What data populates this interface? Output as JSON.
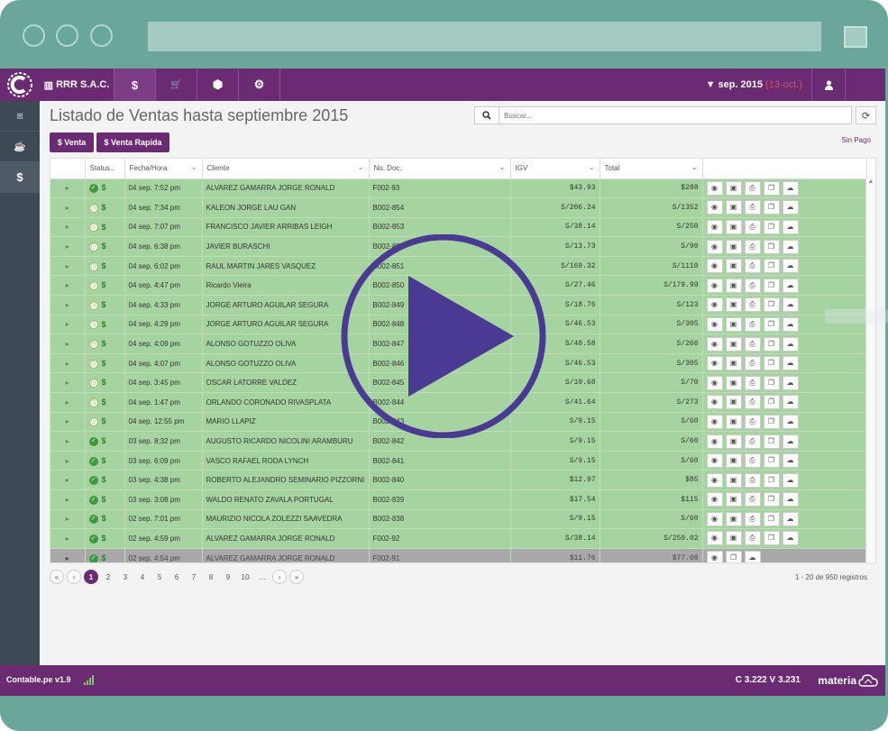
{
  "browser": {
    "window_dots": 3
  },
  "header": {
    "logo_icon": "company-c-logo",
    "company": "RRR S.A.C.",
    "nav": [
      {
        "name": "dollar-icon",
        "glyph": "$"
      },
      {
        "name": "cart-icon",
        "glyph": "🛒"
      },
      {
        "name": "box-icon",
        "glyph": "⬢"
      },
      {
        "name": "gears-icon",
        "glyph": "⚙"
      }
    ],
    "period": "sep. 2015",
    "period_note": "(13-oct.)",
    "filter_icon": "filter-icon",
    "user_icon": "user-icon"
  },
  "sidebar": {
    "items": [
      {
        "name": "menu-icon",
        "glyph": "≡"
      },
      {
        "name": "coffee-icon",
        "glyph": "☕"
      },
      {
        "name": "dollar-icon",
        "glyph": "$"
      }
    ]
  },
  "main": {
    "title": "Listado de Ventas hasta septiembre 2015",
    "search_placeholder": "Buscar...",
    "buttons": {
      "venta": "$ Venta",
      "venta_rapida": "$ Venta Rapida"
    },
    "sin_pago": "Sin Pago",
    "columns": [
      "Status..",
      "Fecha/Hora",
      "Cliente",
      "No. Doc.",
      "IGV",
      "Total"
    ],
    "rows": [
      {
        "status": "ok",
        "fecha": "04 sep. 7:52 pm",
        "cliente": "ALVAREZ GAMARRA JORGE RONALD",
        "doc": "F002-93",
        "igv": "$43.93",
        "total": "$288"
      },
      {
        "status": "pending",
        "fecha": "04 sep. 7:34 pm",
        "cliente": "KALEON JORGE LAU GAN",
        "doc": "B002-854",
        "igv": "S/206.24",
        "total": "S/1352"
      },
      {
        "status": "pending",
        "fecha": "04 sep. 7:07 pm",
        "cliente": "FRANCISCO JAVIER ARRIBAS LEIGH",
        "doc": "B002-853",
        "igv": "S/38.14",
        "total": "S/250"
      },
      {
        "status": "pending",
        "fecha": "04 sep. 6:38 pm",
        "cliente": "JAVIER BURASCHI",
        "doc": "B002-852",
        "igv": "S/13.73",
        "total": "S/90"
      },
      {
        "status": "pending",
        "fecha": "04 sep. 6:02 pm",
        "cliente": "RAUL MARTIN JARES VASQUEZ",
        "doc": "B002-851",
        "igv": "S/169.32",
        "total": "S/1110"
      },
      {
        "status": "pending",
        "fecha": "04 sep. 4:47 pm",
        "cliente": "Ricardo Vieira",
        "doc": "B002-850",
        "igv": "S/27.46",
        "total": "S/179.99"
      },
      {
        "status": "pending",
        "fecha": "04 sep. 4:33 pm",
        "cliente": "JORGE ARTURO AGUILAR SEGURA",
        "doc": "B002-849",
        "igv": "S/18.76",
        "total": "S/123"
      },
      {
        "status": "pending",
        "fecha": "04 sep. 4:29 pm",
        "cliente": "JORGE ARTURO AGUILAR SEGURA",
        "doc": "B002-848",
        "igv": "S/46.53",
        "total": "S/305"
      },
      {
        "status": "pending",
        "fecha": "04 sep. 4:09 pm",
        "cliente": "ALONSO GOTUZZO OLIVA",
        "doc": "B002-847",
        "igv": "S/40.58",
        "total": "S/266"
      },
      {
        "status": "pending",
        "fecha": "04 sep. 4:07 pm",
        "cliente": "ALONSO GOTUZZO OLIVA",
        "doc": "B002-846",
        "igv": "S/46.53",
        "total": "S/305"
      },
      {
        "status": "pending",
        "fecha": "04 sep. 3:45 pm",
        "cliente": "OSCAR LATORRE VALDEZ",
        "doc": "B002-845",
        "igv": "S/10.68",
        "total": "S/70"
      },
      {
        "status": "pending",
        "fecha": "04 sep. 1:47 pm",
        "cliente": "ORLANDO CORONADO RIVASPLATA",
        "doc": "B002-844",
        "igv": "S/41.64",
        "total": "S/273"
      },
      {
        "status": "pending",
        "fecha": "04 sep. 12:55 pm",
        "cliente": "MARIO LLAPIZ",
        "doc": "B002-843",
        "igv": "S/9.15",
        "total": "S/60"
      },
      {
        "status": "ok",
        "fecha": "03 sep. 8:32 pm",
        "cliente": "AUGUSTO RICARDO NICOLINI ARAMBURU",
        "doc": "B002-842",
        "igv": "S/9.15",
        "total": "S/60"
      },
      {
        "status": "ok",
        "fecha": "03 sep. 6:09 pm",
        "cliente": "VASCO RAFAEL RODA LYNCH",
        "doc": "B002-841",
        "igv": "S/9.15",
        "total": "S/60"
      },
      {
        "status": "ok",
        "fecha": "03 sep. 4:38 pm",
        "cliente": "ROBERTO ALEJANDRO SEMINARIO PIZZORNI",
        "doc": "B002-840",
        "igv": "$12.97",
        "total": "$85"
      },
      {
        "status": "ok",
        "fecha": "03 sep. 3:08 pm",
        "cliente": "WALDO RENATO ZAVALA PORTUGAL",
        "doc": "B002-839",
        "igv": "$17.54",
        "total": "$115"
      },
      {
        "status": "ok",
        "fecha": "02 sep. 7:01 pm",
        "cliente": "MAURIZIO NICOLA ZOLEZZI SAAVEDRA",
        "doc": "B002-838",
        "igv": "S/9.15",
        "total": "S/60"
      },
      {
        "status": "ok",
        "fecha": "02 sep. 4:59 pm",
        "cliente": "ALVAREZ GAMARRA JORGE RONALD",
        "doc": "F002-92",
        "igv": "S/38.14",
        "total": "S/250.02"
      },
      {
        "status": "ok",
        "fecha": "02 sep. 4:54 pm",
        "cliente": "ALVAREZ GAMARRA JORGE RONALD",
        "doc": "F002-91",
        "igv": "$11.76",
        "total": "$77.08",
        "selected": true
      }
    ],
    "row_actions": [
      "eye-icon",
      "document-icon",
      "print-icon",
      "copy-icon",
      "cloud-upload-icon"
    ],
    "pagination": {
      "pages": [
        "1",
        "2",
        "3",
        "4",
        "5",
        "6",
        "7",
        "8",
        "9",
        "10",
        "..."
      ],
      "current": "1",
      "count_text": "1 - 20 de 950 registros"
    }
  },
  "footer": {
    "app_version": "Contable.pe v1.9",
    "stats": "C 3.222 V 3.231",
    "brand": "materia"
  },
  "overlay": {
    "play_icon": "play-button-icon",
    "color": "#4a3a93"
  }
}
